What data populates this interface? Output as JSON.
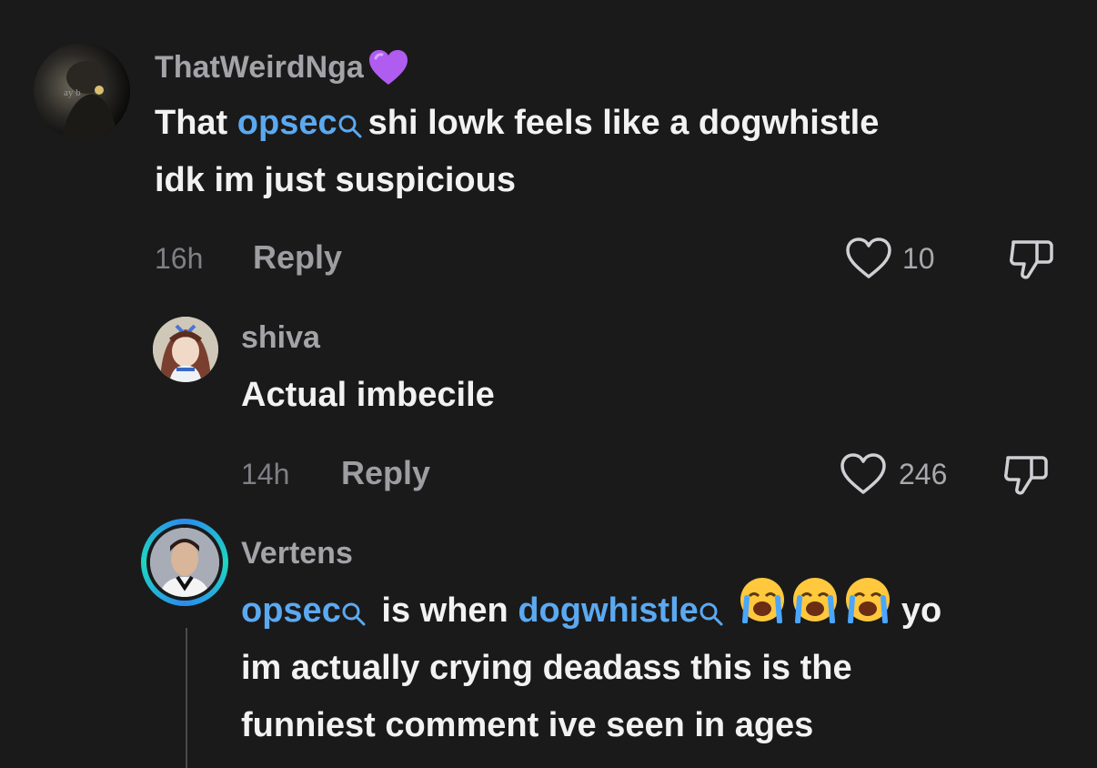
{
  "comments": [
    {
      "username": "ThatWeirdNga",
      "badge_icon": "purple-heart-icon",
      "text": {
        "line1_pre": "That",
        "keyword": "opsec",
        "line1_post": "shi lowk feels like a dogwhistle",
        "line2": "idk im just suspicious"
      },
      "time": "16h",
      "reply_label": "Reply",
      "likes": "10"
    },
    {
      "username": "shiva",
      "text": "Actual imbecile",
      "time": "14h",
      "reply_label": "Reply",
      "likes": "246"
    },
    {
      "username": "Vertens",
      "text": {
        "keyword1": "opsec",
        "mid": "is when",
        "keyword2": "dogwhistle",
        "emoji": "loudly-crying-face-icon",
        "line1_post": "yo",
        "line2": "im actually crying deadass this is the",
        "line3": "funniest comment ive seen in ages"
      }
    }
  ],
  "colors": {
    "background": "#1a1a1b",
    "keyword": "#5ba9f0",
    "username": "#a3a3a8",
    "badge": "#b05cf0"
  }
}
